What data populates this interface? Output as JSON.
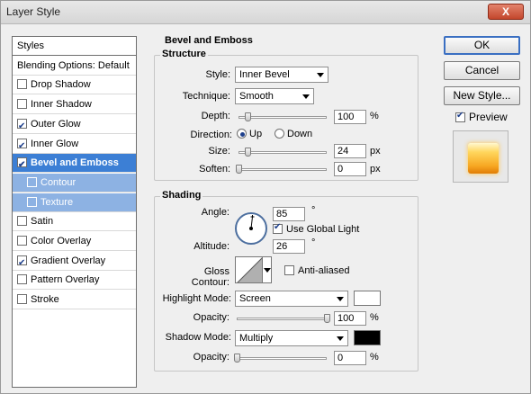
{
  "window": {
    "title": "Layer Style",
    "close_glyph": "X"
  },
  "styles_list": {
    "header": "Styles",
    "items": [
      {
        "label": "Blending Options: Default",
        "checkbox": null
      },
      {
        "label": "Drop Shadow",
        "checked": false
      },
      {
        "label": "Inner Shadow",
        "checked": false
      },
      {
        "label": "Outer Glow",
        "checked": true
      },
      {
        "label": "Inner Glow",
        "checked": true
      },
      {
        "label": "Bevel and Emboss",
        "checked": true,
        "active": true
      },
      {
        "label": "Contour",
        "checked": false,
        "sub": true
      },
      {
        "label": "Texture",
        "checked": false,
        "sub": true
      },
      {
        "label": "Satin",
        "checked": false
      },
      {
        "label": "Color Overlay",
        "checked": false
      },
      {
        "label": "Gradient Overlay",
        "checked": true
      },
      {
        "label": "Pattern Overlay",
        "checked": false
      },
      {
        "label": "Stroke",
        "checked": false
      }
    ]
  },
  "bevel": {
    "section_title": "Bevel and Emboss",
    "structure": {
      "title": "Structure",
      "style_label": "Style:",
      "style_value": "Inner Bevel",
      "technique_label": "Technique:",
      "technique_value": "Smooth",
      "depth_label": "Depth:",
      "depth_value": "100",
      "depth_unit": "%",
      "depth_fraction": 0.1,
      "direction_label": "Direction:",
      "direction_up": "Up",
      "direction_down": "Down",
      "direction_selected": "Up",
      "size_label": "Size:",
      "size_value": "24",
      "size_unit": "px",
      "size_fraction": 0.1,
      "soften_label": "Soften:",
      "soften_value": "0",
      "soften_unit": "px",
      "soften_fraction": 0.0
    },
    "shading": {
      "title": "Shading",
      "angle_label": "Angle:",
      "angle_value": "85",
      "angle_unit": "°",
      "global_light_label": "Use Global Light",
      "global_light_checked": true,
      "altitude_label": "Altitude:",
      "altitude_value": "26",
      "altitude_unit": "°",
      "gloss_label": "Gloss Contour:",
      "anti_aliased_label": "Anti-aliased",
      "anti_aliased_checked": false,
      "highlight_label": "Highlight Mode:",
      "highlight_value": "Screen",
      "highlight_color": "#ffffff",
      "highlight_opacity_label": "Opacity:",
      "highlight_opacity_value": "100",
      "highlight_opacity_unit": "%",
      "highlight_opacity_fraction": 1.0,
      "shadow_label": "Shadow Mode:",
      "shadow_value": "Multiply",
      "shadow_color": "#000000",
      "shadow_opacity_label": "Opacity:",
      "shadow_opacity_value": "0",
      "shadow_opacity_unit": "%",
      "shadow_opacity_fraction": 0.0
    }
  },
  "buttons": {
    "ok": "OK",
    "cancel": "Cancel",
    "new_style": "New Style...",
    "preview_label": "Preview",
    "preview_checked": true
  }
}
